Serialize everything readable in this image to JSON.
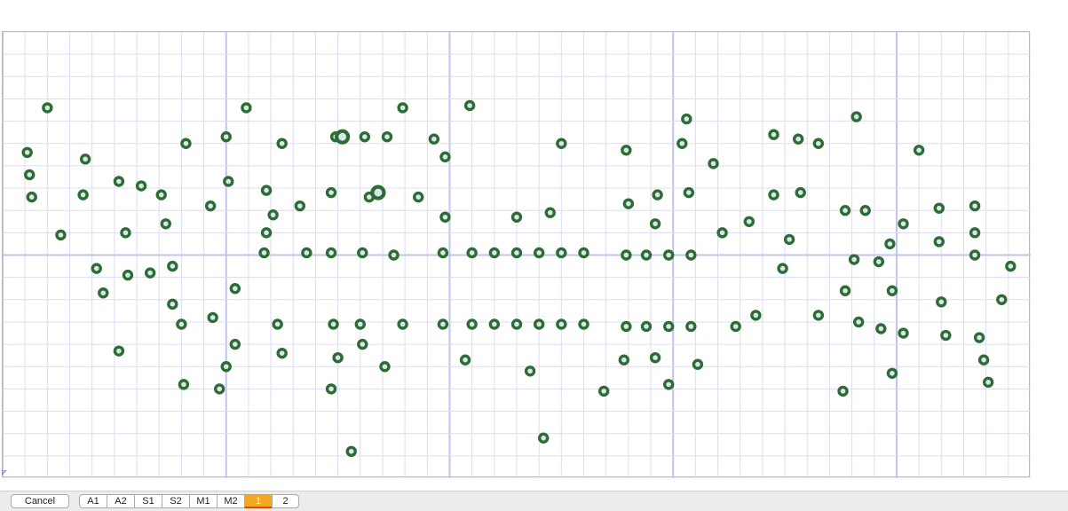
{
  "colors": {
    "dot_stroke": "#2e6b35",
    "dot_fill": "#d8e8ea",
    "grid_minor": "#dcdcf2",
    "grid_major": "#c2c2ee",
    "active_tab": "#f5a623"
  },
  "toolbar": {
    "cancel_label": "Cancel",
    "tabs": [
      "A1",
      "A2",
      "S1",
      "S2",
      "M1",
      "M2",
      "1",
      "2"
    ],
    "active_tab": "1"
  },
  "chart_data": {
    "type": "scatter",
    "grid": true,
    "x_range": [
      0,
      46
    ],
    "y_range": [
      0,
      20
    ],
    "points": [
      [
        1.1,
        14.6
      ],
      [
        1.2,
        13.6
      ],
      [
        1.3,
        12.6
      ],
      [
        2.0,
        16.6
      ],
      [
        2.6,
        10.9
      ],
      [
        3.7,
        14.3
      ],
      [
        3.6,
        12.7
      ],
      [
        4.2,
        9.4
      ],
      [
        4.5,
        8.3
      ],
      [
        5.2,
        5.7
      ],
      [
        5.2,
        13.3
      ],
      [
        5.5,
        11.0
      ],
      [
        5.6,
        9.1
      ],
      [
        6.2,
        13.1
      ],
      [
        6.6,
        9.2
      ],
      [
        7.1,
        12.7
      ],
      [
        7.3,
        11.4
      ],
      [
        7.6,
        9.5
      ],
      [
        7.6,
        7.8
      ],
      [
        8.0,
        6.9
      ],
      [
        8.1,
        4.2
      ],
      [
        8.2,
        15.0
      ],
      [
        9.3,
        12.2
      ],
      [
        9.4,
        7.2
      ],
      [
        9.7,
        4.0
      ],
      [
        10.0,
        15.3
      ],
      [
        10.1,
        13.3
      ],
      [
        10.0,
        5.0
      ],
      [
        10.4,
        6.0
      ],
      [
        10.4,
        8.5
      ],
      [
        10.9,
        16.6
      ],
      [
        11.7,
        10.1
      ],
      [
        12.1,
        11.8
      ],
      [
        11.8,
        11.0
      ],
      [
        12.5,
        15.0
      ],
      [
        11.8,
        12.9
      ],
      [
        12.3,
        6.9
      ],
      [
        12.5,
        5.6
      ],
      [
        13.3,
        12.2
      ],
      [
        13.6,
        10.1
      ],
      [
        14.7,
        12.8
      ],
      [
        14.7,
        10.1
      ],
      [
        14.8,
        6.9
      ],
      [
        14.7,
        4.0
      ],
      [
        15.0,
        5.4
      ],
      [
        14.9,
        15.3
      ],
      [
        15.6,
        1.2
      ],
      [
        16.1,
        10.1
      ],
      [
        16.0,
        6.9
      ],
      [
        16.1,
        6.0
      ],
      [
        16.2,
        15.3
      ],
      [
        16.4,
        12.6
      ],
      [
        17.1,
        5.0
      ],
      [
        17.9,
        16.6
      ],
      [
        17.5,
        10.0
      ],
      [
        17.9,
        6.9
      ],
      [
        17.2,
        15.3
      ],
      [
        18.6,
        12.6
      ],
      [
        19.3,
        15.2
      ],
      [
        19.8,
        14.4
      ],
      [
        19.7,
        10.1
      ],
      [
        19.8,
        11.7
      ],
      [
        19.7,
        6.9
      ],
      [
        20.7,
        5.3
      ],
      [
        20.9,
        16.7
      ],
      [
        21.0,
        10.1
      ],
      [
        21.0,
        6.9
      ],
      [
        22.0,
        10.1
      ],
      [
        22.0,
        6.9
      ],
      [
        23.0,
        10.1
      ],
      [
        23.0,
        11.7
      ],
      [
        23.0,
        6.9
      ],
      [
        24.0,
        10.1
      ],
      [
        24.0,
        6.9
      ],
      [
        23.6,
        4.8
      ],
      [
        24.5,
        11.9
      ],
      [
        24.2,
        1.8
      ],
      [
        25.0,
        10.1
      ],
      [
        25.0,
        6.9
      ],
      [
        25.0,
        15.0
      ],
      [
        26.0,
        10.1
      ],
      [
        26.0,
        6.9
      ],
      [
        26.9,
        3.9
      ],
      [
        27.9,
        14.7
      ],
      [
        28.0,
        12.3
      ],
      [
        27.9,
        10.0
      ],
      [
        27.9,
        6.8
      ],
      [
        27.8,
        5.3
      ],
      [
        28.8,
        10.0
      ],
      [
        28.8,
        6.8
      ],
      [
        29.2,
        11.4
      ],
      [
        29.3,
        12.7
      ],
      [
        29.2,
        5.4
      ],
      [
        29.8,
        10.0
      ],
      [
        29.8,
        6.8
      ],
      [
        29.8,
        4.2
      ],
      [
        30.4,
        15.0
      ],
      [
        30.6,
        16.1
      ],
      [
        30.7,
        12.8
      ],
      [
        30.8,
        10.0
      ],
      [
        30.8,
        6.8
      ],
      [
        31.1,
        5.1
      ],
      [
        31.8,
        14.1
      ],
      [
        32.2,
        11.0
      ],
      [
        32.8,
        6.8
      ],
      [
        33.4,
        11.5
      ],
      [
        33.7,
        7.3
      ],
      [
        34.5,
        15.4
      ],
      [
        34.5,
        12.7
      ],
      [
        34.9,
        9.4
      ],
      [
        35.2,
        10.7
      ],
      [
        35.6,
        15.2
      ],
      [
        35.7,
        12.8
      ],
      [
        36.5,
        15.0
      ],
      [
        36.5,
        7.3
      ],
      [
        37.7,
        12.0
      ],
      [
        37.7,
        8.4
      ],
      [
        38.1,
        9.8
      ],
      [
        38.2,
        16.2
      ],
      [
        38.3,
        7.0
      ],
      [
        37.6,
        3.9
      ],
      [
        38.6,
        12.0
      ],
      [
        39.2,
        9.7
      ],
      [
        39.3,
        6.7
      ],
      [
        39.7,
        10.5
      ],
      [
        39.8,
        8.4
      ],
      [
        39.8,
        4.7
      ],
      [
        40.3,
        11.4
      ],
      [
        40.3,
        6.5
      ],
      [
        41.0,
        14.7
      ],
      [
        41.9,
        12.1
      ],
      [
        41.9,
        10.6
      ],
      [
        42.0,
        7.9
      ],
      [
        42.2,
        6.4
      ],
      [
        43.5,
        12.2
      ],
      [
        43.5,
        11.0
      ],
      [
        43.5,
        10.0
      ],
      [
        43.7,
        6.3
      ],
      [
        43.9,
        5.3
      ],
      [
        44.1,
        4.3
      ],
      [
        44.7,
        8.0
      ],
      [
        45.1,
        9.5
      ]
    ],
    "large_points": [
      [
        15.2,
        15.3
      ],
      [
        16.8,
        12.8
      ]
    ]
  }
}
